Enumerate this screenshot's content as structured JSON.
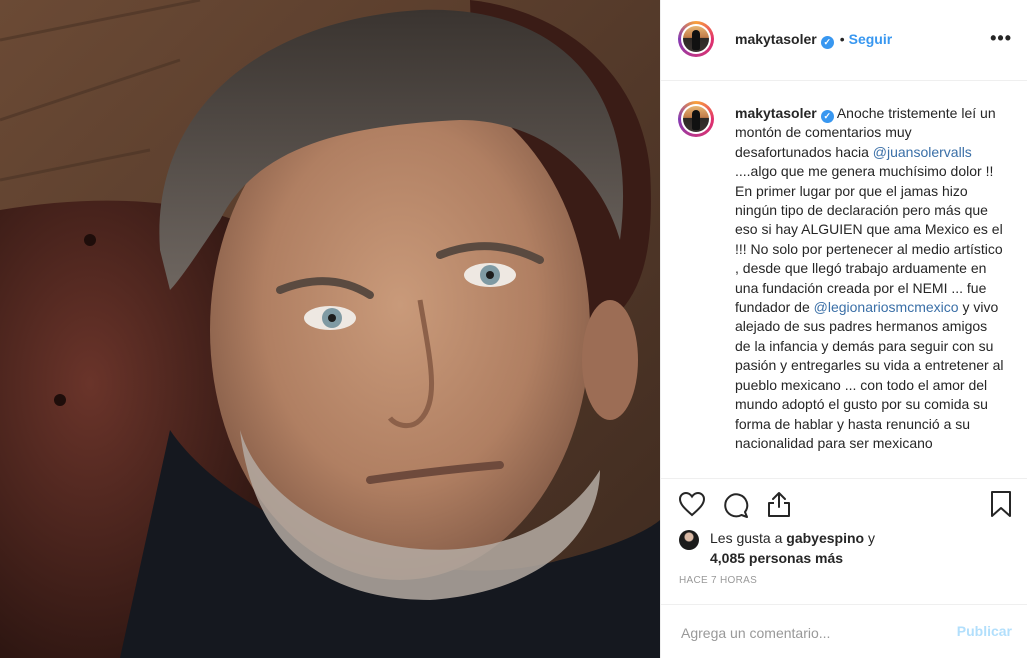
{
  "post": {
    "username": "makytasoler",
    "follow_label": "Seguir",
    "separator": "•",
    "more_label": "•••",
    "verified_mark": "✓",
    "caption_before": "Anoche tristemente leí un montón de comentarios muy desafortunados hacia ",
    "mention1": "@juansolervalls",
    "caption_middle": " ....algo que me genera muchísimo dolor !! En primer lugar por que el jamas hizo ningún tipo de declaración pero más que eso si hay ALGUIEN que ama Mexico es el !!! No solo por pertenecer al medio artístico , desde que llegó trabajo arduamente en una fundación creada por el NEMI ... fue fundador de ",
    "mention2": "@legionariosmcmexico",
    "caption_after": " y vivo alejado de sus padres hermanos amigos de la infancia y demás para seguir con su pasión y entregarles su vida a entretener al pueblo mexicano ... con todo el amor del mundo adoptó el gusto por su comida su forma de hablar y hasta renunció a su nacionalidad para ser mexicano",
    "likes_prefix": "Les gusta a",
    "likes_user": "gabyespino",
    "likes_and": "y",
    "likes_count": "4,085 personas más",
    "time_label": "HACE 7 HORAS",
    "comment_placeholder": "Agrega un comentario...",
    "publish_label": "Publicar"
  },
  "icons": {
    "like": "heart-icon",
    "comment": "comment-bubble-icon",
    "share": "share-icon",
    "save": "bookmark-icon"
  },
  "colors": {
    "link_blue": "#3897f0",
    "mention_blue": "#3a6fa7",
    "publish_disabled": "#b2dffc",
    "border": "#efefef"
  }
}
